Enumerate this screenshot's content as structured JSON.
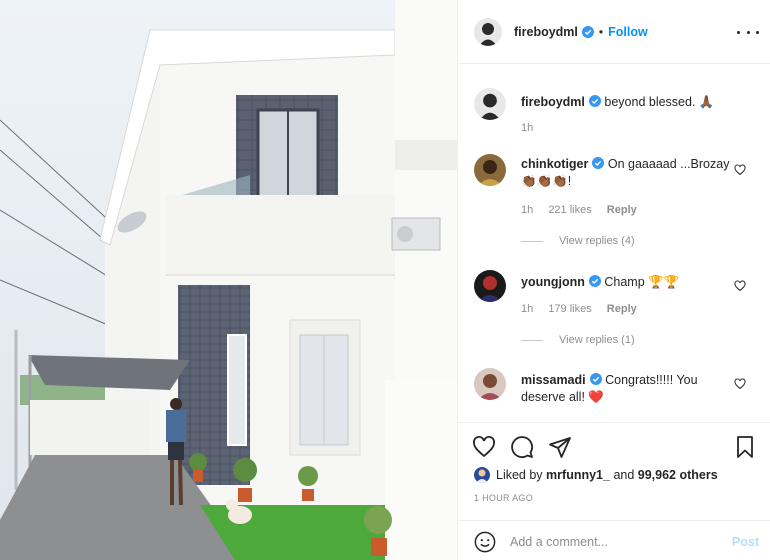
{
  "post": {
    "author": "fireboydml",
    "follow_label": "Follow",
    "separator": "•",
    "caption": {
      "user": "fireboydml",
      "text": "beyond blessed. 🙏🏾",
      "time": "1h"
    }
  },
  "comments": [
    {
      "user": "chinkotiger",
      "text": "On gaaaaad ...Brozay 👏🏾👏🏾👏🏾!",
      "time": "1h",
      "likes": "221 likes",
      "reply_label": "Reply",
      "view_replies": "View replies (4)"
    },
    {
      "user": "youngjonn",
      "text": "Champ 🏆🏆",
      "time": "1h",
      "likes": "179 likes",
      "reply_label": "Reply",
      "view_replies": "View replies (1)"
    },
    {
      "user": "missamadi",
      "text": "Congrats!!!!! You deserve all! ❤️"
    }
  ],
  "actions": {
    "icons": [
      "heart-icon",
      "comment-icon",
      "share-icon",
      "bookmark-icon"
    ]
  },
  "likes": {
    "prefix": "Liked by",
    "user": "mrfunny1_",
    "middle": "and",
    "others": "99,962 others"
  },
  "timestamp": "1 HOUR AGO",
  "add_comment": {
    "placeholder": "Add a comment...",
    "post_label": "Post"
  },
  "colors": {
    "accent": "#0095f6",
    "verified": "#3897f0",
    "post_disabled": "#b2dffc",
    "muted": "#8e8e8e",
    "text": "#262626"
  }
}
